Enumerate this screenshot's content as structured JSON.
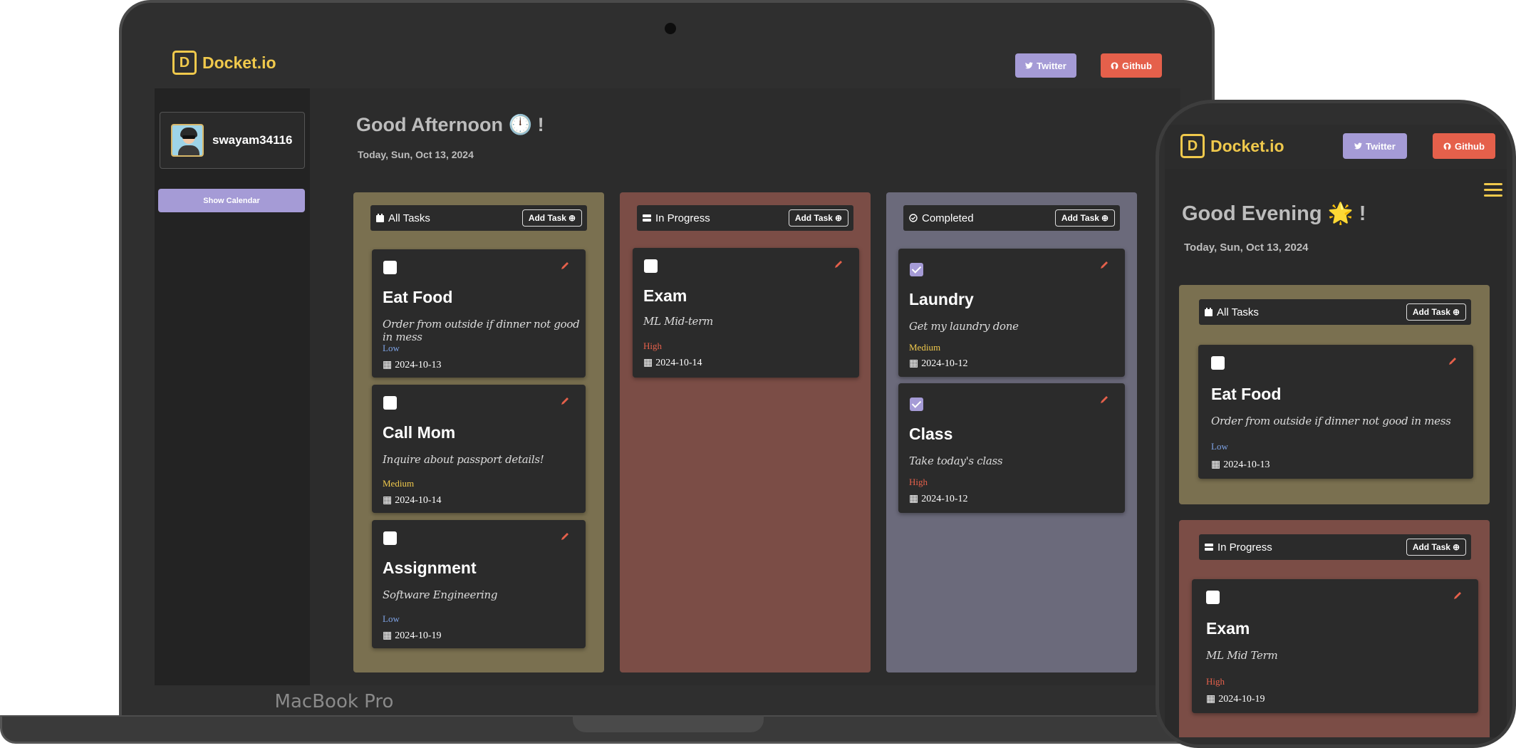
{
  "brand": {
    "logo_letter": "D",
    "name": "Docket.io",
    "accent": "#f0c94c"
  },
  "nav": {
    "twitter_label": "Twitter",
    "github_label": "Github"
  },
  "sidebar": {
    "username": "swayam34116",
    "calendar_button": "Show Calendar"
  },
  "desktop": {
    "greeting": "Good Afternoon 🕛 !",
    "date": "Today, Sun, Oct 13, 2024",
    "columns": [
      {
        "title": "All Tasks",
        "add_label": "Add Task",
        "tasks": [
          {
            "title": "Eat Food",
            "desc": "Order from outside if dinner not good in mess",
            "priority": "Low",
            "due": "2024-10-13",
            "done": false
          },
          {
            "title": "Call Mom",
            "desc": "Inquire about passport details!",
            "priority": "Medium",
            "due": "2024-10-14",
            "done": false
          },
          {
            "title": "Assignment",
            "desc": "Software Engineering",
            "priority": "Low",
            "due": "2024-10-19",
            "done": false
          }
        ]
      },
      {
        "title": "In Progress",
        "add_label": "Add Task",
        "tasks": [
          {
            "title": "Exam",
            "desc": "ML Mid-term",
            "priority": "High",
            "due": "2024-10-14",
            "done": false
          }
        ]
      },
      {
        "title": "Completed",
        "add_label": "Add Task",
        "tasks": [
          {
            "title": "Laundry",
            "desc": "Get my laundry done",
            "priority": "Medium",
            "due": "2024-10-12",
            "done": true
          },
          {
            "title": "Class",
            "desc": "Take today's class",
            "priority": "High",
            "due": "2024-10-12",
            "done": true
          }
        ]
      }
    ]
  },
  "mobile": {
    "greeting": "Good Evening 🌟 !",
    "date": "Today, Sun, Oct 13, 2024",
    "columns": [
      {
        "title": "All Tasks",
        "add_label": "Add Task",
        "tasks": [
          {
            "title": "Eat Food",
            "desc": "Order from outside if dinner not good in mess",
            "priority": "Low",
            "due": "2024-10-13",
            "done": false
          }
        ]
      },
      {
        "title": "In Progress",
        "add_label": "Add Task",
        "tasks": [
          {
            "title": "Exam",
            "desc": "ML Mid Term",
            "priority": "High",
            "due": "2024-10-19",
            "done": false
          }
        ]
      }
    ]
  },
  "device_label": "MacBook Pro",
  "colors": {
    "twitter": "#a59bd6",
    "github": "#e5604b",
    "col_all": "#7a7050",
    "col_progress": "#7b4d46",
    "col_done": "#6b6a7b"
  }
}
